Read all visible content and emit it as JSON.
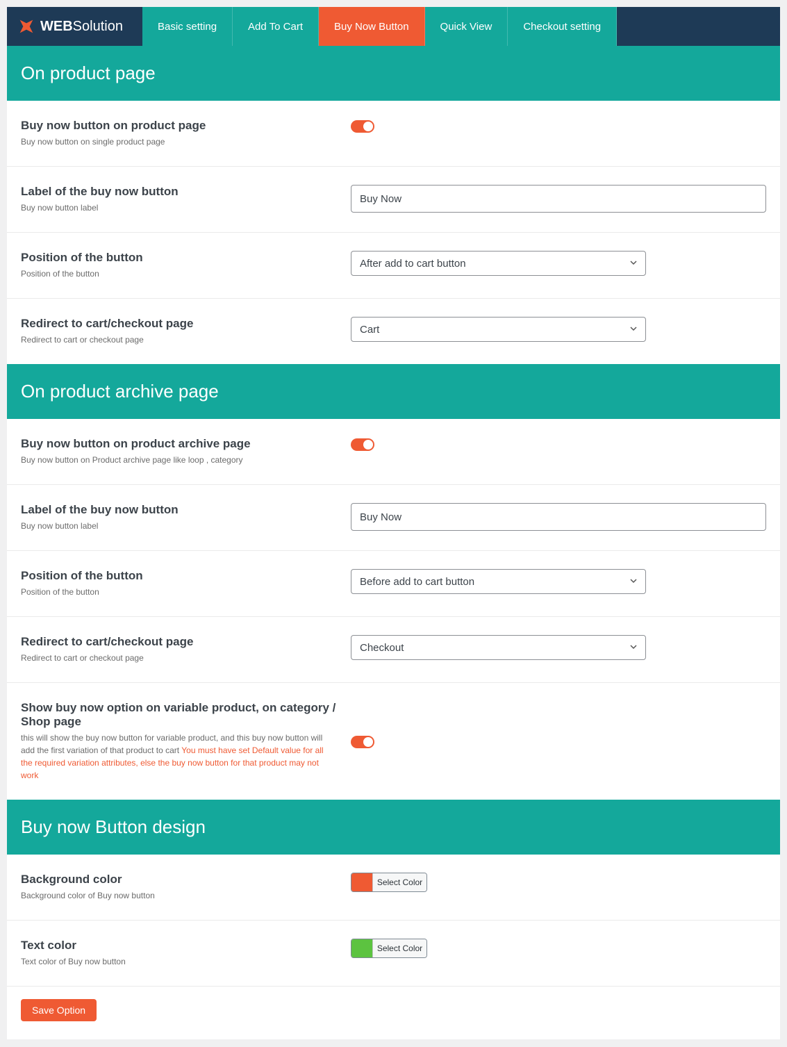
{
  "brand": {
    "strong": "WEB",
    "light": "Solution"
  },
  "tabs": [
    {
      "label": "Basic setting",
      "active": false
    },
    {
      "label": "Add To Cart",
      "active": false
    },
    {
      "label": "Buy Now Button",
      "active": true
    },
    {
      "label": "Quick View",
      "active": false
    },
    {
      "label": "Checkout setting",
      "active": false
    }
  ],
  "sections": {
    "product_page": {
      "header": "On product page",
      "enable": {
        "title": "Buy now button on product page",
        "desc": "Buy now button on single product page",
        "on": true
      },
      "label": {
        "title": "Label of the buy now button",
        "desc": "Buy now button label",
        "value": "Buy Now"
      },
      "position": {
        "title": "Position of the button",
        "desc": "Position of the button",
        "value": "After add to cart button"
      },
      "redirect": {
        "title": "Redirect to cart/checkout page",
        "desc": "Redirect to cart or checkout page",
        "value": "Cart"
      }
    },
    "archive_page": {
      "header": "On product archive page",
      "enable": {
        "title": "Buy now button on product archive page",
        "desc": "Buy now button on Product archive page like loop , category",
        "on": true
      },
      "label": {
        "title": "Label of the buy now button",
        "desc": "Buy now button label",
        "value": "Buy Now"
      },
      "position": {
        "title": "Position of the button",
        "desc": "Position of the button",
        "value": "Before add to cart button"
      },
      "redirect": {
        "title": "Redirect to cart/checkout page",
        "desc": "Redirect to cart or checkout page",
        "value": "Checkout"
      },
      "variable": {
        "title": "Show buy now option on variable product, on category / Shop page",
        "desc": "this will show the buy now button for variable product, and this buy now button will add the first variation of that product to cart ",
        "warn": "You must have set Default value for all the required variation attributes, else the buy now button for that product may not work",
        "on": true
      }
    },
    "design": {
      "header": "Buy now Button design",
      "bg": {
        "title": "Background color",
        "desc": "Background color of Buy now button",
        "color": "#ef5a33",
        "button_label": "Select Color"
      },
      "text": {
        "title": "Text color",
        "desc": "Text color of Buy now button",
        "color": "#5cc340",
        "button_label": "Select Color"
      }
    }
  },
  "save_label": "Save Option"
}
